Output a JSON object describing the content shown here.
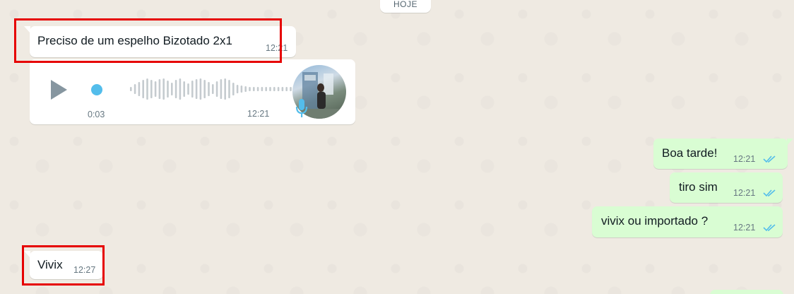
{
  "date_separator": "HOJE",
  "messages": [
    {
      "id": "m1",
      "direction": "incoming",
      "text": "Preciso de um espelho Bizotado 2x1",
      "time": "12:21"
    },
    {
      "id": "m2",
      "direction": "incoming",
      "type": "voice",
      "duration": "0:03",
      "time": "12:21"
    },
    {
      "id": "m3",
      "direction": "outgoing",
      "text": "Boa tarde!",
      "time": "12:21"
    },
    {
      "id": "m4",
      "direction": "outgoing",
      "text": "tiro sim",
      "time": "12:21"
    },
    {
      "id": "m5",
      "direction": "outgoing",
      "text": "vivix ou importado ?",
      "time": "12:21"
    },
    {
      "id": "m6",
      "direction": "incoming",
      "text": "Vivix",
      "time": "12:27"
    }
  ],
  "colors": {
    "background": "#efeae2",
    "incoming_bubble": "#ffffff",
    "outgoing_bubble": "#d9fdd3",
    "read_ticks": "#53bdeb",
    "highlight": "#e60000",
    "voice_dot": "#53bdeb"
  },
  "icons": {
    "play": "play-icon",
    "mic": "microphone-icon",
    "read": "double-check-icon"
  }
}
